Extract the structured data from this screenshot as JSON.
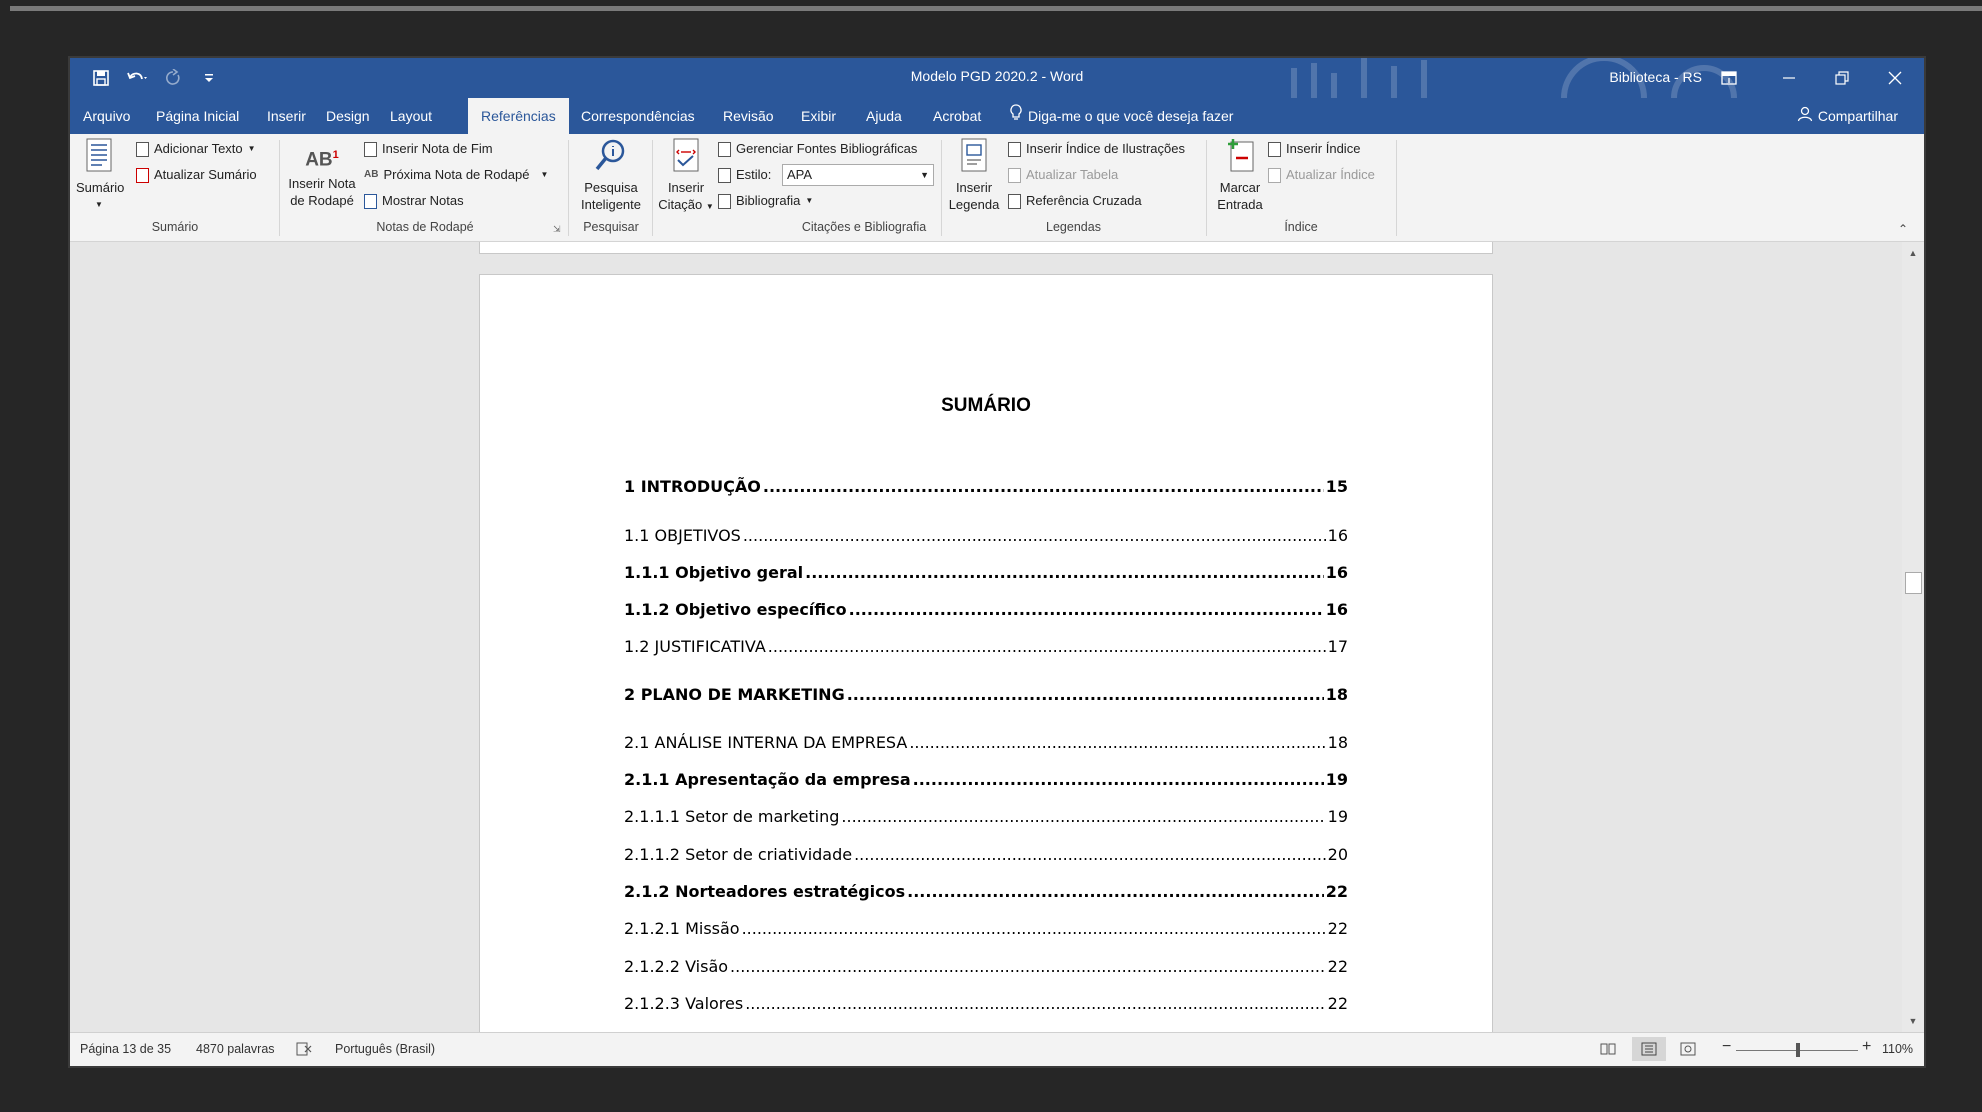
{
  "window": {
    "title": "Modelo PGD 2020.2  -  Word",
    "user": "Biblioteca - RS"
  },
  "tabs": [
    "Arquivo",
    "Página Inicial",
    "Inserir",
    "Design",
    "Layout",
    "Referências",
    "Correspondências",
    "Revisão",
    "Exibir",
    "Ajuda",
    "Acrobat"
  ],
  "active_tab": "Referências",
  "tell_me": "Diga-me o que você deseja fazer",
  "share": "Compartilhar",
  "ribbon": {
    "sumario": {
      "big": "Sumário",
      "add_text": "Adicionar Texto",
      "update": "Atualizar Sumário",
      "label": "Sumário"
    },
    "notas": {
      "big1": "Inserir Nota",
      "big2": "de Rodapé",
      "insert_end": "Inserir Nota de Fim",
      "next": "Próxima Nota de Rodapé",
      "show": "Mostrar Notas",
      "label": "Notas de Rodapé"
    },
    "pesquisar": {
      "big1": "Pesquisa",
      "big2": "Inteligente",
      "label": "Pesquisar"
    },
    "citacoes": {
      "big1": "Inserir",
      "big2": "Citação",
      "manage": "Gerenciar Fontes Bibliográficas",
      "style_label": "Estilo:",
      "style_value": "APA",
      "bibliography": "Bibliografia",
      "label": "Citações e Bibliografia"
    },
    "legendas": {
      "big1": "Inserir",
      "big2": "Legenda",
      "insert_index": "Inserir Índice de Ilustrações",
      "update_table": "Atualizar Tabela",
      "cross_ref": "Referência Cruzada",
      "label": "Legendas"
    },
    "indice": {
      "big1": "Marcar",
      "big2": "Entrada",
      "insert": "Inserir Índice",
      "update": "Atualizar Índice",
      "label": "Índice"
    }
  },
  "document": {
    "heading": "SUMÁRIO",
    "toc": [
      {
        "text": "1 INTRODUÇÃO",
        "page": "15",
        "bold": true
      },
      {
        "text": "1.1 OBJETIVOS",
        "page": "16",
        "bold": false
      },
      {
        "text": "1.1.1 Objetivo geral",
        "page": "16",
        "bold": true
      },
      {
        "text": "1.1.2 Objetivo específico",
        "page": "16",
        "bold": true
      },
      {
        "text": "1.2 JUSTIFICATIVA",
        "page": "17",
        "bold": false
      },
      {
        "text": "2 PLANO DE MARKETING",
        "page": "18",
        "bold": true
      },
      {
        "text": "2.1 ANÁLISE INTERNA DA EMPRESA",
        "page": "18",
        "bold": false
      },
      {
        "text": "2.1.1 Apresentação da empresa",
        "page": "19",
        "bold": true
      },
      {
        "text": "2.1.1.1 Setor de marketing",
        "page": "19",
        "bold": false
      },
      {
        "text": "2.1.1.2 Setor de criatividade",
        "page": "20",
        "bold": false
      },
      {
        "text": "2.1.2 Norteadores estratégicos",
        "page": "22",
        "bold": true
      },
      {
        "text": "2.1.2.1 Missão",
        "page": "22",
        "bold": false
      },
      {
        "text": "2.1.2.2 Visão",
        "page": "22",
        "bold": false
      },
      {
        "text": "2.1.2.3 Valores",
        "page": "22",
        "bold": false
      }
    ]
  },
  "status": {
    "page": "Página 13 de 35",
    "words": "4870 palavras",
    "language": "Português (Brasil)",
    "zoom": "110%"
  },
  "colors": {
    "accent": "#2b579a",
    "ribbon_bg": "#f3f3f3",
    "canvas": "#e6e6e6"
  },
  "icons": [
    "save-icon",
    "undo-icon",
    "redo-icon",
    "customize-icon",
    "ribbon-display-icon",
    "minimize-icon",
    "restore-icon",
    "close-icon",
    "lightbulb-icon",
    "person-icon"
  ]
}
